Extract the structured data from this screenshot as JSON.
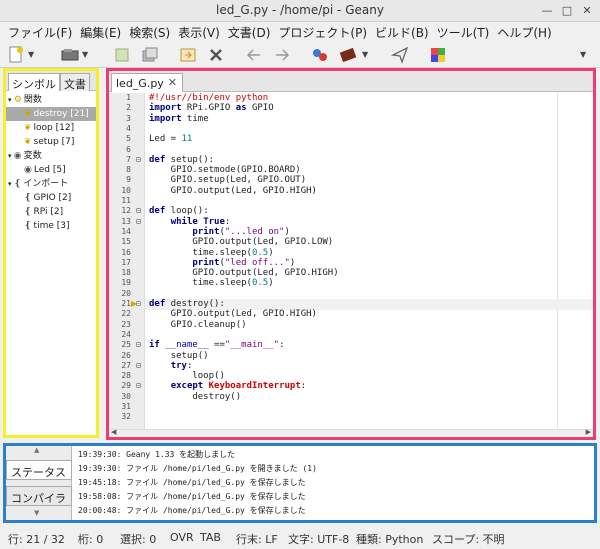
{
  "window": {
    "title": "led_G.py - /home/pi - Geany"
  },
  "menu": [
    "ファイル(F)",
    "編集(E)",
    "検索(S)",
    "表示(V)",
    "文書(D)",
    "プロジェクト(P)",
    "ビルド(B)",
    "ツール(T)",
    "ヘルプ(H)"
  ],
  "sidebar": {
    "tabs": [
      "シンボル",
      "文書"
    ],
    "tree": [
      {
        "label": "関数",
        "level": 0,
        "icon": "function-group-icon",
        "expanded": true
      },
      {
        "label": "destroy [21]",
        "level": 1,
        "icon": "method-icon",
        "selected": true
      },
      {
        "label": "loop [12]",
        "level": 1,
        "icon": "method-icon"
      },
      {
        "label": "setup [7]",
        "level": 1,
        "icon": "method-icon"
      },
      {
        "label": "変数",
        "level": 0,
        "icon": "variable-group-icon",
        "expanded": true
      },
      {
        "label": "Led [5]",
        "level": 1,
        "icon": "variable-icon"
      },
      {
        "label": "インポート",
        "level": 0,
        "icon": "import-group-icon",
        "expanded": true
      },
      {
        "label": "GPIO [2]",
        "level": 1,
        "icon": "import-icon"
      },
      {
        "label": "RPi [2]",
        "level": 1,
        "icon": "import-icon"
      },
      {
        "label": "time [3]",
        "level": 1,
        "icon": "import-icon"
      }
    ]
  },
  "editor": {
    "tab_label": "led_G.py",
    "current_line": 21,
    "lines": [
      "#!/usr//bin/env python",
      "import RPi.GPIO as GPIO",
      "import time",
      "",
      "Led = 11",
      "",
      "def setup():",
      "    GPIO.setmode(GPIO.BOARD)",
      "    GPIO.setup(Led, GPIO.OUT)",
      "    GPIO.output(Led, GPIO.HIGH)",
      "",
      "def loop():",
      "    while True:",
      "        print(\"...led on\")",
      "        GPIO.output(Led, GPIO.LOW)",
      "        time.sleep(0.5)",
      "        print(\"led off...\")",
      "        GPIO.output(Led, GPIO.HIGH)",
      "        time.sleep(0.5)",
      "",
      "def destroy():",
      "    GPIO.output(Led, GPIO.HIGH)",
      "    GPIO.cleanup()",
      "",
      "if __name__ ==\"__main__\":",
      "    setup()",
      "    try:",
      "        loop()",
      "    except KeyboardInterrupt:",
      "        destroy()",
      "",
      ""
    ]
  },
  "messages": {
    "tabs": [
      "ステータス",
      "コンパイラ"
    ],
    "lines": [
      "19:39:30: Geany 1.33 を起動しました",
      "19:39:30: ファイル /home/pi/led_G.py を開きました (1)",
      "19:45:18: ファイル /home/pi/led_G.py を保存しました",
      "19:58:08: ファイル /home/pi/led_G.py を保存しました",
      "20:00:48: ファイル /home/pi/led_G.py を保存しました"
    ]
  },
  "status": {
    "line": "行: 21 / 32",
    "col": "桁: 0",
    "sel": "選択: 0",
    "ovr": "OVR",
    "tab": "TAB",
    "eol": "行末: LF",
    "enc": "文字: UTF-8",
    "type": "種類: Python",
    "scope": "スコープ: 不明"
  },
  "colors": {
    "sidebar_frame": "#f6ef2a",
    "editor_frame": "#ee3b76",
    "messages_frame": "#2a7fd1"
  }
}
